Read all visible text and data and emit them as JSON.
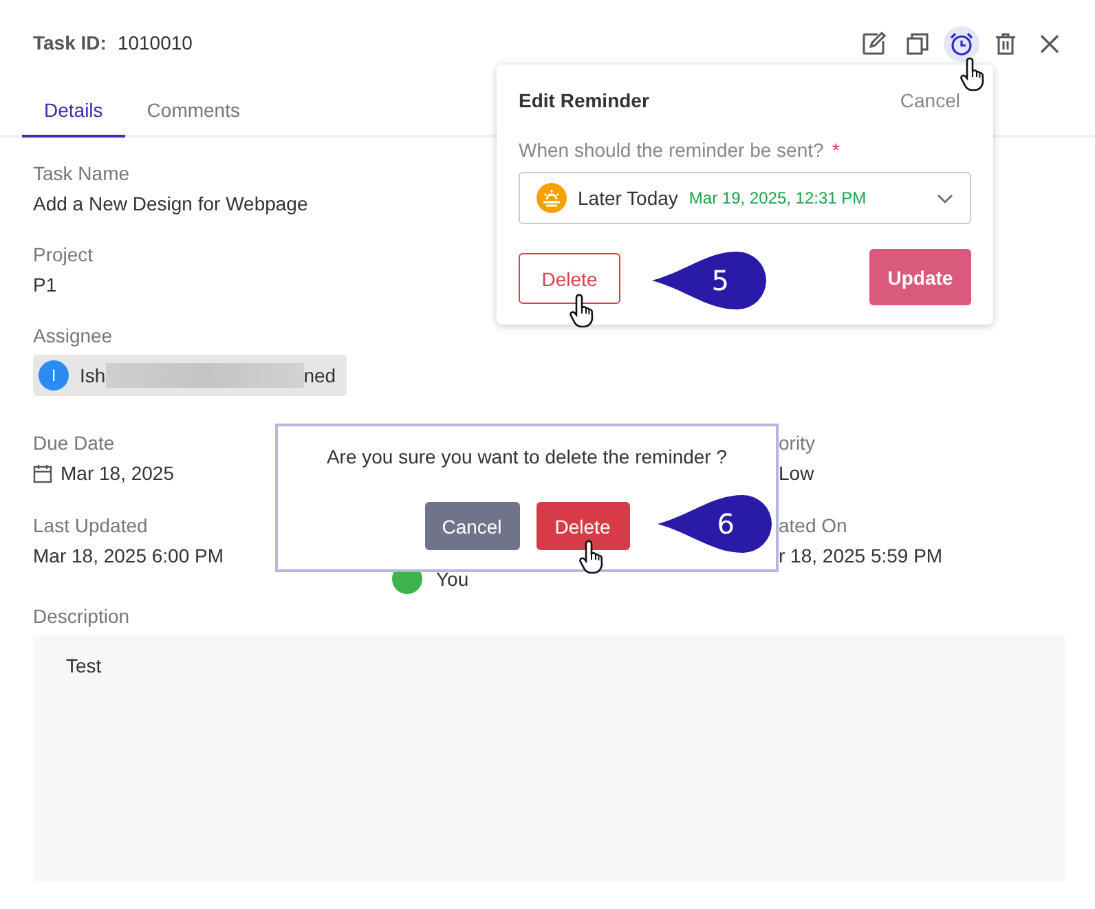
{
  "task": {
    "id_label": "Task ID:",
    "id": "1010010"
  },
  "toolbar": [
    {
      "kind": "edit",
      "selected": false
    },
    {
      "kind": "copy",
      "selected": false
    },
    {
      "kind": "reminder",
      "selected": true
    },
    {
      "kind": "delete",
      "selected": false
    },
    {
      "kind": "close",
      "selected": false
    }
  ],
  "tabs": [
    {
      "label": "Details",
      "selected": true
    },
    {
      "label": "Comments",
      "selected": false
    }
  ],
  "fields": {
    "task_name": {
      "label": "Task Name",
      "value": "Add a New Design for Webpage"
    },
    "project": {
      "label": "Project",
      "value": "P1"
    },
    "assignee": {
      "label": "Assignee",
      "initial": "I",
      "name_start": "Ish",
      "name_end": "ned"
    },
    "due_date": {
      "label": "Due Date",
      "value": "Mar 18, 2025"
    },
    "priority": {
      "label": "ority",
      "value": "Low"
    },
    "last_updated": {
      "label": "Last Updated",
      "value": "Mar 18, 2025 6:00 PM"
    },
    "created_by": {
      "value": "You"
    },
    "created_on": {
      "label": "ated On",
      "value": "r 18, 2025 5:59 PM"
    },
    "description": {
      "label": "Description",
      "value": "Test"
    }
  },
  "reminder_popover": {
    "title": "Edit Reminder",
    "cancel": "Cancel",
    "question": "When should the reminder be sent?",
    "required_mark": "*",
    "option": {
      "label": "Later Today",
      "time": "Mar 19, 2025, 12:31 PM"
    },
    "delete_button": "Delete",
    "update_button": "Update"
  },
  "confirm_dialog": {
    "message": "Are you sure you want to delete the reminder ?",
    "cancel_button": "Cancel",
    "delete_button": "Delete"
  },
  "callouts": [
    "5",
    "6"
  ]
}
